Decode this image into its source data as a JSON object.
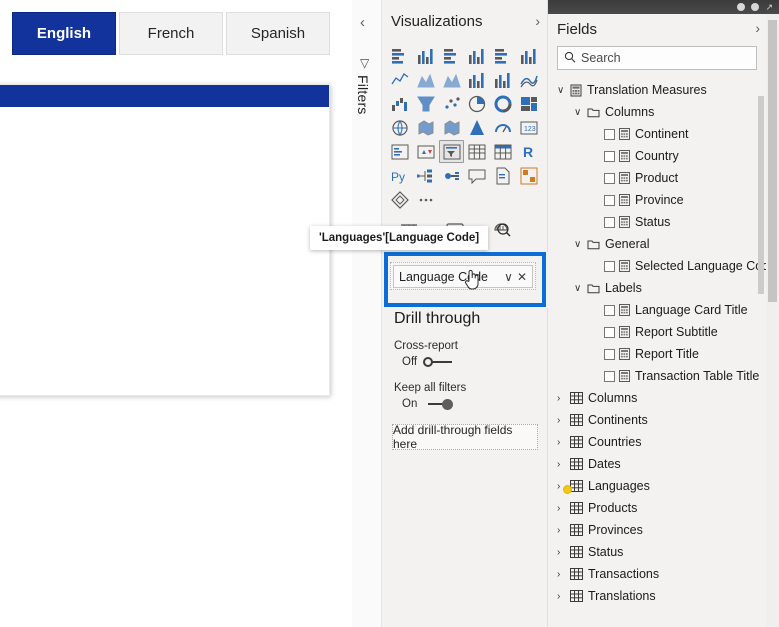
{
  "canvas": {
    "slicer": {
      "name": "language-slicer",
      "buttons": [
        {
          "label": "English",
          "selected": true
        },
        {
          "label": "French",
          "selected": false
        },
        {
          "label": "Spanish",
          "selected": false
        }
      ]
    },
    "card": {
      "header_color": "#12339c",
      "body_text": ""
    }
  },
  "filters_rail": {
    "label": "Filters",
    "chevron": "‹",
    "filter_icon": "▽"
  },
  "visualizations": {
    "title": "Visualizations",
    "chevron": "›",
    "icons": [
      "stacked-bar-chart-icon",
      "stacked-column-chart-icon",
      "clustered-bar-chart-icon",
      "clustered-column-chart-icon",
      "100-stacked-bar-chart-icon",
      "100-stacked-column-chart-icon",
      "line-chart-icon",
      "area-chart-icon",
      "stacked-area-chart-icon",
      "line-stacked-column-chart-icon",
      "line-clustered-column-chart-icon",
      "ribbon-chart-icon",
      "waterfall-chart-icon",
      "funnel-chart-icon",
      "scatter-chart-icon",
      "pie-chart-icon",
      "donut-chart-icon",
      "treemap-icon",
      "map-icon",
      "filled-map-icon",
      "shape-map-icon",
      "azure-map-icon",
      "gauge-icon",
      "card-icon",
      "multi-row-card-icon",
      "kpi-icon",
      "slicer-icon",
      "table-icon",
      "matrix-icon",
      "r-script-visual-icon",
      "python-visual-icon",
      "decomposition-tree-icon",
      "key-influencers-icon",
      "smart-narrative-icon",
      "paginated-report-icon",
      "power-apps-icon",
      "more-visuals-icon",
      "ellipsis-icon"
    ],
    "selected_icon": "slicer-icon",
    "extra_icons": [
      "format-bar-icon",
      "format-card-icon",
      "analytics-magnifier-icon"
    ],
    "field_well": {
      "pill_label": "Language Code",
      "dropdown_icon": "∨",
      "remove_icon": "✕",
      "highlighted": true
    },
    "tooltip": "'Languages'[Language Code]",
    "drill_through": {
      "title": "Drill through",
      "cross_report": {
        "label": "Cross-report",
        "state": "Off"
      },
      "keep_all_filters": {
        "label": "Keep all filters",
        "state": "On"
      },
      "drop_zone": "Add drill-through fields here"
    }
  },
  "fields": {
    "title": "Fields",
    "chevron": "›",
    "search": {
      "placeholder": "Search",
      "icon": "search-icon"
    },
    "tree": [
      {
        "label": "Translation Measures",
        "level": 1,
        "twisty": "∨",
        "icon": "measure-table-icon",
        "checkbox": false
      },
      {
        "label": "Columns",
        "level": 2,
        "twisty": "∨",
        "icon": "folder-icon",
        "checkbox": false
      },
      {
        "label": "Continent",
        "level": 3,
        "twisty": "",
        "icon": "measure-icon",
        "checkbox": true
      },
      {
        "label": "Country",
        "level": 3,
        "twisty": "",
        "icon": "measure-icon",
        "checkbox": true
      },
      {
        "label": "Product",
        "level": 3,
        "twisty": "",
        "icon": "measure-icon",
        "checkbox": true
      },
      {
        "label": "Province",
        "level": 3,
        "twisty": "",
        "icon": "measure-icon",
        "checkbox": true
      },
      {
        "label": "Status",
        "level": 3,
        "twisty": "",
        "icon": "measure-icon",
        "checkbox": true
      },
      {
        "label": "General",
        "level": 2,
        "twisty": "∨",
        "icon": "folder-icon",
        "checkbox": false
      },
      {
        "label": "Selected Language Code",
        "level": 3,
        "twisty": "",
        "icon": "measure-icon",
        "checkbox": true
      },
      {
        "label": "Labels",
        "level": 2,
        "twisty": "∨",
        "icon": "folder-icon",
        "checkbox": false
      },
      {
        "label": "Language Card Title",
        "level": 3,
        "twisty": "",
        "icon": "measure-icon",
        "checkbox": true
      },
      {
        "label": "Report Subtitle",
        "level": 3,
        "twisty": "",
        "icon": "measure-icon",
        "checkbox": true
      },
      {
        "label": "Report Title",
        "level": 3,
        "twisty": "",
        "icon": "measure-icon",
        "checkbox": true
      },
      {
        "label": "Transaction Table Title",
        "level": 3,
        "twisty": "",
        "icon": "measure-icon",
        "checkbox": true
      },
      {
        "label": "Columns",
        "level": 1,
        "twisty": "›",
        "icon": "table-icon",
        "checkbox": false
      },
      {
        "label": "Continents",
        "level": 1,
        "twisty": "›",
        "icon": "table-icon",
        "checkbox": false
      },
      {
        "label": "Countries",
        "level": 1,
        "twisty": "›",
        "icon": "table-icon",
        "checkbox": false
      },
      {
        "label": "Dates",
        "level": 1,
        "twisty": "›",
        "icon": "table-icon",
        "checkbox": false
      },
      {
        "label": "Languages",
        "level": 1,
        "twisty": "›",
        "icon": "table-icon",
        "checkbox": false,
        "badge": true
      },
      {
        "label": "Products",
        "level": 1,
        "twisty": "›",
        "icon": "table-icon",
        "checkbox": false
      },
      {
        "label": "Provinces",
        "level": 1,
        "twisty": "›",
        "icon": "table-icon",
        "checkbox": false
      },
      {
        "label": "Status",
        "level": 1,
        "twisty": "›",
        "icon": "table-icon",
        "checkbox": false
      },
      {
        "label": "Transactions",
        "level": 1,
        "twisty": "›",
        "icon": "table-icon",
        "checkbox": false
      },
      {
        "label": "Translations",
        "level": 1,
        "twisty": "›",
        "icon": "table-icon",
        "checkbox": false
      }
    ]
  },
  "titlebar": {
    "icons": [
      "help-circle-icon",
      "info-circle-icon",
      "share-arrow-icon"
    ]
  },
  "colors": {
    "accent_blue": "#12339c",
    "highlight_blue": "#0b6ed6",
    "badge_yellow": "#f2c811",
    "pane_bg": "#f3f2f1"
  }
}
